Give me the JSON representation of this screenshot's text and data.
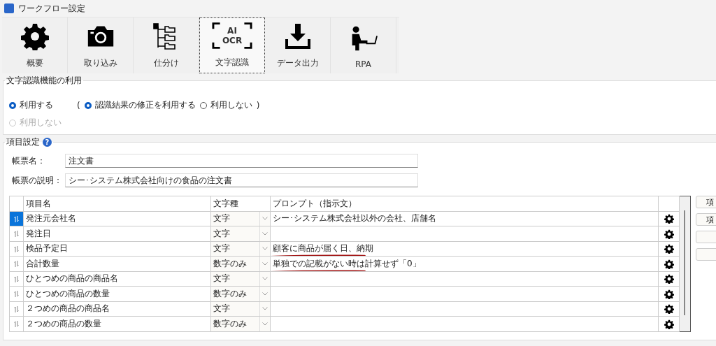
{
  "window": {
    "title": "ワークフロー設定"
  },
  "tabs": [
    {
      "label": "概要",
      "kind": "gear",
      "selected": false
    },
    {
      "label": "取り込み",
      "kind": "camera",
      "selected": false
    },
    {
      "label": "仕分け",
      "kind": "tree",
      "selected": false
    },
    {
      "label": "文字認識",
      "kind": "ocr",
      "icon_text": [
        "AI",
        "OCR"
      ],
      "selected": true
    },
    {
      "label": "データ出力",
      "kind": "download",
      "selected": false
    },
    {
      "label": "RPA",
      "kind": "person",
      "selected": false
    }
  ],
  "usage_group": {
    "title": "文字認識機能の利用",
    "options": [
      {
        "label": "利用する",
        "selected": true,
        "disabled": false
      },
      {
        "label": "利用しない",
        "selected": false,
        "disabled": true
      }
    ],
    "open_paren": "(",
    "close_paren": ")",
    "sub_options": [
      {
        "label": "認識結果の修正を利用する",
        "selected": true
      },
      {
        "label": "利用しない",
        "selected": false
      }
    ]
  },
  "item_group": {
    "title": "項目設定",
    "help_icon": "?",
    "fields": [
      {
        "label": "帳票名：",
        "value": "注文書"
      },
      {
        "label": "帳票の説明：",
        "value": "シー･システム株式会社向けの食品の注文書"
      }
    ],
    "table": {
      "columns": [
        "項目名",
        "文字種",
        "プロンプト（指示文）"
      ],
      "rows": [
        {
          "name": "発注元会社名",
          "type": "文字",
          "prompt": "シー･システム株式会社以外の会社、店舗名",
          "selected": true
        },
        {
          "name": "発注日",
          "type": "文字",
          "selected": false
        },
        {
          "name": "検品予定日",
          "type": "文字",
          "prompt": "顧客に商品が届く日、納期",
          "selected": false,
          "marked": true
        },
        {
          "name": "合計数量",
          "type": "数字のみ",
          "prompt": "単独での記載がない時は計算せず「0」",
          "selected": false,
          "marked": true
        },
        {
          "name": "ひとつめの商品の商品名",
          "type": "文字",
          "selected": false
        },
        {
          "name": "ひとつめの商品の数量",
          "type": "数字のみ",
          "selected": false
        },
        {
          "name": "２つめの商品の商品名",
          "type": "文字",
          "selected": false
        },
        {
          "name": "２つめの商品の数量",
          "type": "数字のみ",
          "selected": false
        }
      ]
    },
    "side_buttons": [
      {
        "kind": "label",
        "label": "項"
      },
      {
        "kind": "label",
        "label": "項"
      },
      {
        "kind": "blank"
      },
      {
        "kind": "blank"
      }
    ]
  }
}
